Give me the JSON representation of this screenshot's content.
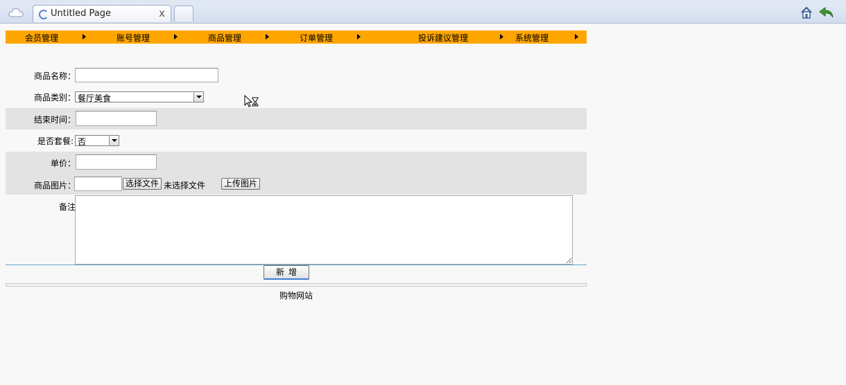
{
  "browser": {
    "tab_title": "Untitled Page",
    "tab_close": "x"
  },
  "nav": {
    "items": [
      {
        "label": "会员管理"
      },
      {
        "label": "账号管理"
      },
      {
        "label": "商品管理"
      },
      {
        "label": "订单管理"
      },
      {
        "label": "投诉建议管理"
      },
      {
        "label": "系统管理"
      }
    ],
    "color": "#ffa500"
  },
  "form": {
    "name_label": "商品名称：",
    "name_value": "",
    "category_label": "商品类别：",
    "category_value": "餐厅美食",
    "end_time_label": "结束时间：",
    "end_time_value": "",
    "package_label": "是否套餐:",
    "package_value": "否",
    "price_label": "单价：",
    "price_value": "",
    "image_label": "商品图片：",
    "choose_file_label": "选择文件",
    "no_file_text": "未选择文件",
    "upload_label": "上传图片",
    "remark_label": "备注",
    "remark_value": "",
    "submit_label": "新增"
  },
  "footer": {
    "text": "购物网站"
  },
  "icons": [
    "cloud-icon",
    "loading-spinner-icon",
    "home-icon",
    "back-arrow-icon",
    "busy-cursor-icon"
  ]
}
